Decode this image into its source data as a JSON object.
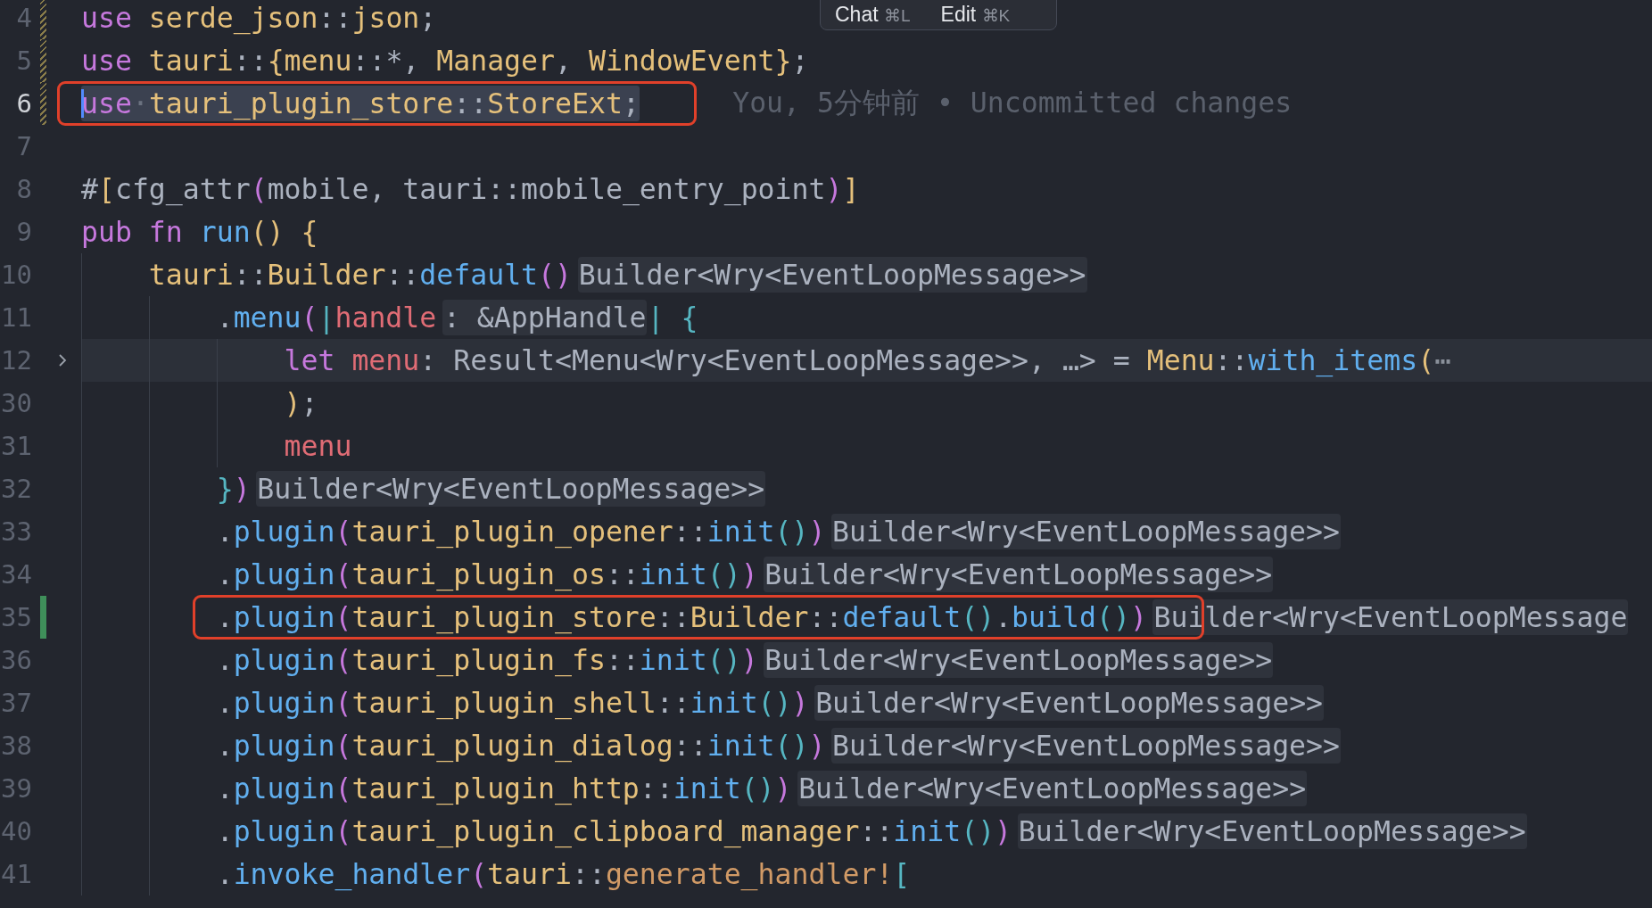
{
  "popup": {
    "buttons": [
      {
        "label": "Chat",
        "shortcut": "⌘L"
      },
      {
        "label": "Edit",
        "shortcut": "⌘K"
      }
    ]
  },
  "lines": [
    {
      "number": "4",
      "modified": true,
      "added": false,
      "cursor": false,
      "selected": false,
      "folded": false,
      "boxed": false,
      "tokens": [
        {
          "kind": "kw",
          "text": "use"
        },
        {
          "kind": "ty",
          "text": "serde_json"
        },
        {
          "kind": "tx",
          "text": "::"
        },
        {
          "kind": "ty",
          "text": "json"
        },
        {
          "kind": "tx",
          "text": ";"
        }
      ]
    },
    {
      "number": "5",
      "modified": true,
      "added": false,
      "cursor": false,
      "selected": false,
      "folded": false,
      "boxed": false,
      "tokens": [
        {
          "kind": "kw",
          "text": "use"
        },
        {
          "kind": "ty",
          "text": "tauri"
        },
        {
          "kind": "tx",
          "text": "::"
        },
        {
          "kind": "b1",
          "text": "{"
        },
        {
          "kind": "ty",
          "text": "menu"
        },
        {
          "kind": "tx",
          "text": "::*,"
        },
        {
          "kind": "ty",
          "text": "Manager"
        },
        {
          "kind": "tx",
          "text": ","
        },
        {
          "kind": "ty",
          "text": "WindowEvent"
        },
        {
          "kind": "b1",
          "text": "}"
        },
        {
          "kind": "tx",
          "text": ";"
        }
      ]
    },
    {
      "number": "6",
      "modified": true,
      "added": false,
      "cursor": true,
      "selected": true,
      "folded": false,
      "boxed": true,
      "blame": "You, 5分钟前 • Uncommitted changes",
      "tokens": [
        {
          "kind": "kw",
          "text": "use"
        },
        {
          "kind": "dot",
          "text": "·"
        },
        {
          "kind": "ty",
          "text": "tauri_plugin_store"
        },
        {
          "kind": "tx",
          "text": "::"
        },
        {
          "kind": "ty",
          "text": "StoreExt"
        },
        {
          "kind": "tx",
          "text": ";"
        }
      ]
    },
    {
      "number": "7",
      "modified": false,
      "added": false,
      "cursor": false,
      "selected": false,
      "folded": false,
      "boxed": false
    },
    {
      "number": "8",
      "modified": false,
      "added": false,
      "cursor": false,
      "selected": false,
      "folded": false,
      "boxed": false,
      "tokens": [
        {
          "kind": "tx",
          "text": "#"
        },
        {
          "kind": "b1",
          "text": "["
        },
        {
          "kind": "tx",
          "text": "cfg_attr"
        },
        {
          "kind": "b2",
          "text": "("
        },
        {
          "kind": "tx",
          "text": "mobile,"
        },
        {
          "kind": "tx",
          "text": "tauri::mobile_entry_point"
        },
        {
          "kind": "b2",
          "text": ")"
        },
        {
          "kind": "b1",
          "text": "]"
        }
      ]
    },
    {
      "number": "9",
      "modified": false,
      "added": false,
      "cursor": false,
      "selected": false,
      "folded": false,
      "boxed": false,
      "tokens": [
        {
          "kind": "kw",
          "text": "pub"
        },
        {
          "kind": "kw",
          "text": "fn"
        },
        {
          "kind": "fn",
          "text": "run"
        },
        {
          "kind": "b1",
          "text": "()"
        },
        {
          "kind": "b1",
          "text": "{"
        }
      ],
      "children": [
        {
          "number": "10",
          "modified": false,
          "added": false,
          "cursor": false,
          "selected": false,
          "folded": false,
          "boxed": false,
          "tokens": [
            {
              "kind": "ty",
              "text": "tauri"
            },
            {
              "kind": "tx",
              "text": "::"
            },
            {
              "kind": "ty",
              "text": "Builder"
            },
            {
              "kind": "tx",
              "text": "::"
            },
            {
              "kind": "fn",
              "text": "default"
            },
            {
              "kind": "b2",
              "text": "()"
            },
            {
              "kind": "hint",
              "text": "Builder<Wry<EventLoopMessage>>"
            }
          ],
          "children": [
            {
              "number": "11",
              "modified": false,
              "added": false,
              "cursor": false,
              "selected": false,
              "folded": false,
              "boxed": false,
              "tokens": [
                {
                  "kind": "tx",
                  "text": "."
                },
                {
                  "kind": "fn",
                  "text": "menu"
                },
                {
                  "kind": "b2",
                  "text": "("
                },
                {
                  "kind": "b3",
                  "text": "|"
                },
                {
                  "kind": "var",
                  "text": "handle"
                },
                {
                  "kind": "hint",
                  "text": ": &AppHandle"
                },
                {
                  "kind": "b3",
                  "text": "|"
                },
                {
                  "kind": "b3",
                  "text": "{"
                }
              ],
              "children": [
                {
                  "number": "12",
                  "modified": false,
                  "added": false,
                  "cursor": false,
                  "selected": false,
                  "folded": true,
                  "boxed": false,
                  "tokens": [
                    {
                      "kind": "kw",
                      "text": "let"
                    },
                    {
                      "kind": "var",
                      "text": "menu"
                    },
                    {
                      "kind": "tx",
                      "text": ": Result<Menu<Wry<EventLoopMessage>>, …>"
                    },
                    {
                      "kind": "tx",
                      "text": "="
                    },
                    {
                      "kind": "ty",
                      "text": "Menu"
                    },
                    {
                      "kind": "tx",
                      "text": "::"
                    },
                    {
                      "kind": "fn",
                      "text": "with_items"
                    },
                    {
                      "kind": "b1",
                      "text": "("
                    },
                    {
                      "kind": "fold",
                      "text": "⋯"
                    }
                  ]
                },
                {
                  "number": "30",
                  "modified": false,
                  "added": false,
                  "cursor": false,
                  "selected": false,
                  "folded": false,
                  "boxed": false,
                  "tokens": [
                    {
                      "kind": "b1",
                      "text": ")"
                    },
                    {
                      "kind": "tx",
                      "text": ";"
                    }
                  ]
                },
                {
                  "number": "31",
                  "modified": false,
                  "added": false,
                  "cursor": false,
                  "selected": false,
                  "folded": false,
                  "boxed": false,
                  "tokens": [
                    {
                      "kind": "var",
                      "text": "menu"
                    }
                  ]
                }
              ]
            },
            {
              "number": "32",
              "modified": false,
              "added": false,
              "cursor": false,
              "selected": false,
              "folded": false,
              "boxed": false,
              "tokens": [
                {
                  "kind": "b3",
                  "text": "}"
                },
                {
                  "kind": "b2",
                  "text": ")"
                },
                {
                  "kind": "hint",
                  "text": "Builder<Wry<EventLoopMessage>>"
                }
              ]
            },
            {
              "number": "33",
              "modified": false,
              "added": false,
              "cursor": false,
              "selected": false,
              "folded": false,
              "boxed": false,
              "tokens": [
                {
                  "kind": "tx",
                  "text": "."
                },
                {
                  "kind": "fn",
                  "text": "plugin"
                },
                {
                  "kind": "b2",
                  "text": "("
                },
                {
                  "kind": "ty",
                  "text": "tauri_plugin_opener"
                },
                {
                  "kind": "tx",
                  "text": "::"
                },
                {
                  "kind": "fn",
                  "text": "init"
                },
                {
                  "kind": "b3",
                  "text": "()"
                },
                {
                  "kind": "b2",
                  "text": ")"
                },
                {
                  "kind": "hint",
                  "text": "Builder<Wry<EventLoopMessage>>"
                }
              ]
            },
            {
              "number": "34",
              "modified": false,
              "added": false,
              "cursor": false,
              "selected": false,
              "folded": false,
              "boxed": false,
              "tokens": [
                {
                  "kind": "tx",
                  "text": "."
                },
                {
                  "kind": "fn",
                  "text": "plugin"
                },
                {
                  "kind": "b2",
                  "text": "("
                },
                {
                  "kind": "ty",
                  "text": "tauri_plugin_os"
                },
                {
                  "kind": "tx",
                  "text": "::"
                },
                {
                  "kind": "fn",
                  "text": "init"
                },
                {
                  "kind": "b3",
                  "text": "()"
                },
                {
                  "kind": "b2",
                  "text": ")"
                },
                {
                  "kind": "hint",
                  "text": "Builder<Wry<EventLoopMessage>>"
                }
              ]
            },
            {
              "number": "35",
              "modified": false,
              "added": true,
              "cursor": false,
              "selected": false,
              "folded": false,
              "boxed": true,
              "tokens": [
                {
                  "kind": "tx",
                  "text": "."
                },
                {
                  "kind": "fn",
                  "text": "plugin"
                },
                {
                  "kind": "b2",
                  "text": "("
                },
                {
                  "kind": "ty",
                  "text": "tauri_plugin_store"
                },
                {
                  "kind": "tx",
                  "text": "::"
                },
                {
                  "kind": "ty",
                  "text": "Builder"
                },
                {
                  "kind": "tx",
                  "text": "::"
                },
                {
                  "kind": "fn",
                  "text": "default"
                },
                {
                  "kind": "b3",
                  "text": "()"
                },
                {
                  "kind": "tx",
                  "text": "."
                },
                {
                  "kind": "fn",
                  "text": "build"
                },
                {
                  "kind": "b3",
                  "text": "()"
                },
                {
                  "kind": "b2",
                  "text": ")"
                },
                {
                  "kind": "hint",
                  "text": "Builder<Wry<EventLoopMessage"
                }
              ]
            },
            {
              "number": "36",
              "modified": false,
              "added": false,
              "cursor": false,
              "selected": false,
              "folded": false,
              "boxed": false,
              "tokens": [
                {
                  "kind": "tx",
                  "text": "."
                },
                {
                  "kind": "fn",
                  "text": "plugin"
                },
                {
                  "kind": "b2",
                  "text": "("
                },
                {
                  "kind": "ty",
                  "text": "tauri_plugin_fs"
                },
                {
                  "kind": "tx",
                  "text": "::"
                },
                {
                  "kind": "fn",
                  "text": "init"
                },
                {
                  "kind": "b3",
                  "text": "()"
                },
                {
                  "kind": "b2",
                  "text": ")"
                },
                {
                  "kind": "hint",
                  "text": "Builder<Wry<EventLoopMessage>>"
                }
              ]
            },
            {
              "number": "37",
              "modified": false,
              "added": false,
              "cursor": false,
              "selected": false,
              "folded": false,
              "boxed": false,
              "tokens": [
                {
                  "kind": "tx",
                  "text": "."
                },
                {
                  "kind": "fn",
                  "text": "plugin"
                },
                {
                  "kind": "b2",
                  "text": "("
                },
                {
                  "kind": "ty",
                  "text": "tauri_plugin_shell"
                },
                {
                  "kind": "tx",
                  "text": "::"
                },
                {
                  "kind": "fn",
                  "text": "init"
                },
                {
                  "kind": "b3",
                  "text": "()"
                },
                {
                  "kind": "b2",
                  "text": ")"
                },
                {
                  "kind": "hint",
                  "text": "Builder<Wry<EventLoopMessage>>"
                }
              ]
            },
            {
              "number": "38",
              "modified": false,
              "added": false,
              "cursor": false,
              "selected": false,
              "folded": false,
              "boxed": false,
              "tokens": [
                {
                  "kind": "tx",
                  "text": "."
                },
                {
                  "kind": "fn",
                  "text": "plugin"
                },
                {
                  "kind": "b2",
                  "text": "("
                },
                {
                  "kind": "ty",
                  "text": "tauri_plugin_dialog"
                },
                {
                  "kind": "tx",
                  "text": "::"
                },
                {
                  "kind": "fn",
                  "text": "init"
                },
                {
                  "kind": "b3",
                  "text": "()"
                },
                {
                  "kind": "b2",
                  "text": ")"
                },
                {
                  "kind": "hint",
                  "text": "Builder<Wry<EventLoopMessage>>"
                }
              ]
            },
            {
              "number": "39",
              "modified": false,
              "added": false,
              "cursor": false,
              "selected": false,
              "folded": false,
              "boxed": false,
              "tokens": [
                {
                  "kind": "tx",
                  "text": "."
                },
                {
                  "kind": "fn",
                  "text": "plugin"
                },
                {
                  "kind": "b2",
                  "text": "("
                },
                {
                  "kind": "ty",
                  "text": "tauri_plugin_http"
                },
                {
                  "kind": "tx",
                  "text": "::"
                },
                {
                  "kind": "fn",
                  "text": "init"
                },
                {
                  "kind": "b3",
                  "text": "()"
                },
                {
                  "kind": "b2",
                  "text": ")"
                },
                {
                  "kind": "hint",
                  "text": "Builder<Wry<EventLoopMessage>>"
                }
              ]
            },
            {
              "number": "40",
              "modified": false,
              "added": false,
              "cursor": false,
              "selected": false,
              "folded": false,
              "boxed": false,
              "tokens": [
                {
                  "kind": "tx",
                  "text": "."
                },
                {
                  "kind": "fn",
                  "text": "plugin"
                },
                {
                  "kind": "b2",
                  "text": "("
                },
                {
                  "kind": "ty",
                  "text": "tauri_plugin_clipboard_manager"
                },
                {
                  "kind": "tx",
                  "text": "::"
                },
                {
                  "kind": "fn",
                  "text": "init"
                },
                {
                  "kind": "b3",
                  "text": "()"
                },
                {
                  "kind": "b2",
                  "text": ")"
                },
                {
                  "kind": "hint",
                  "text": "Builder<Wry<EventLoopMessage>>"
                }
              ]
            },
            {
              "number": "41",
              "modified": false,
              "added": false,
              "cursor": false,
              "selected": false,
              "folded": false,
              "boxed": false,
              "tokens": [
                {
                  "kind": "tx",
                  "text": "."
                },
                {
                  "kind": "fn",
                  "text": "invoke_handler"
                },
                {
                  "kind": "b2",
                  "text": "("
                },
                {
                  "kind": "ty",
                  "text": "tauri"
                },
                {
                  "kind": "tx",
                  "text": "::"
                },
                {
                  "kind": "mac",
                  "text": "generate_handler!"
                },
                {
                  "kind": "b3",
                  "text": "["
                }
              ]
            }
          ]
        }
      ]
    }
  ]
}
